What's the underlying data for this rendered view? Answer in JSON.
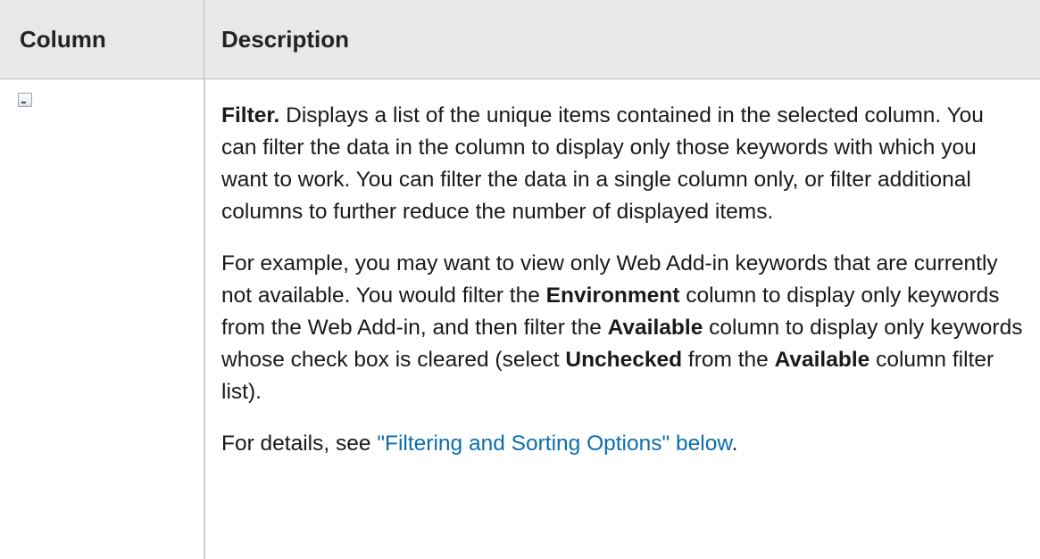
{
  "table": {
    "headers": {
      "column": "Column",
      "description": "Description"
    },
    "row": {
      "icon": "filter-icon",
      "para1": {
        "term": "Filter.",
        "text": " Displays a list of the unique items contained in the selected column. You can filter the data in the column to display only those keywords with which you want to work. You can filter the data in a single column only, or filter additional columns to further reduce the number of displayed items."
      },
      "para2": {
        "t1": "For example, you may want to view only Web Add-in keywords that are currently not available. You would filter the ",
        "b1": "Environment",
        "t2": " column to display only keywords from the Web Add-in, and then filter the ",
        "b2": "Available",
        "t3": " column to display only keywords whose check box is cleared (select ",
        "b3": "Unchecked",
        "t4": " from the ",
        "b4": "Available",
        "t5": " column filter list)."
      },
      "para3": {
        "t1": "For details, see ",
        "link": "\"Filtering and Sorting Options\" below",
        "t2": "."
      }
    }
  }
}
